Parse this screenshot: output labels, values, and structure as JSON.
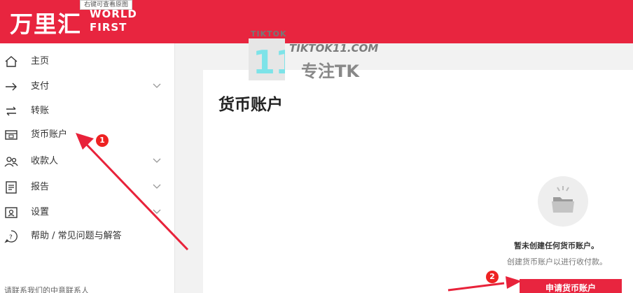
{
  "header": {
    "logo_cn": "万里汇",
    "logo_en_line1": "WORLD",
    "logo_en_line2": "FIRST",
    "tooltip": "右键可查看原图"
  },
  "sidebar": {
    "items": [
      {
        "label": "主页",
        "icon": "home-icon",
        "expandable": false
      },
      {
        "label": "支付",
        "icon": "arrow-right-icon",
        "expandable": true
      },
      {
        "label": "转账",
        "icon": "transfer-icon",
        "expandable": false
      },
      {
        "label": "货币账户",
        "icon": "wallet-icon",
        "expandable": false
      },
      {
        "label": "收款人",
        "icon": "users-icon",
        "expandable": true
      },
      {
        "label": "报告",
        "icon": "report-icon",
        "expandable": true
      },
      {
        "label": "设置",
        "icon": "settings-icon",
        "expandable": true
      },
      {
        "label": "帮助 / 常见问题与解答",
        "icon": "help-icon",
        "expandable": false
      }
    ],
    "footer_text": "请联系我们的中意联系人"
  },
  "main": {
    "title": "货币账户",
    "empty_title": "暂未创建任何货币账户。",
    "empty_desc": "创建货币账户以进行收付款。",
    "apply_button": "申请货币账户"
  },
  "watermark": {
    "small": "TIKTOK",
    "url": "TIKTOK11.COM",
    "cn": "专注TK",
    "number": "11"
  },
  "annotations": {
    "badge1": "1",
    "badge2": "2",
    "color": "#e8223a"
  },
  "colors": {
    "brand": "#e8253f"
  }
}
